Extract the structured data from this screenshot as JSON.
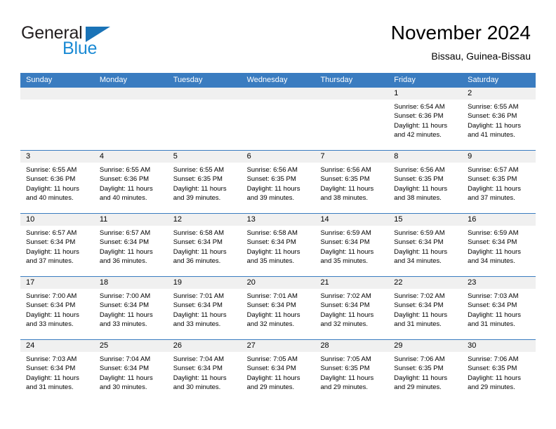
{
  "brand": {
    "name_part1": "General",
    "name_part2": "Blue",
    "accent_color": "#1a8ad4",
    "triangle_color": "#1a73b7"
  },
  "header": {
    "title": "November 2024",
    "subtitle": "Bissau, Guinea-Bissau"
  },
  "calendar": {
    "header_bg": "#3a7cc0",
    "daynum_bg": "#f0f0f0",
    "weekdays": [
      "Sunday",
      "Monday",
      "Tuesday",
      "Wednesday",
      "Thursday",
      "Friday",
      "Saturday"
    ],
    "weeks": [
      [
        {
          "day": "",
          "lines": []
        },
        {
          "day": "",
          "lines": []
        },
        {
          "day": "",
          "lines": []
        },
        {
          "day": "",
          "lines": []
        },
        {
          "day": "",
          "lines": []
        },
        {
          "day": "1",
          "lines": [
            "Sunrise: 6:54 AM",
            "Sunset: 6:36 PM",
            "Daylight: 11 hours",
            "and 42 minutes."
          ]
        },
        {
          "day": "2",
          "lines": [
            "Sunrise: 6:55 AM",
            "Sunset: 6:36 PM",
            "Daylight: 11 hours",
            "and 41 minutes."
          ]
        }
      ],
      [
        {
          "day": "3",
          "lines": [
            "Sunrise: 6:55 AM",
            "Sunset: 6:36 PM",
            "Daylight: 11 hours",
            "and 40 minutes."
          ]
        },
        {
          "day": "4",
          "lines": [
            "Sunrise: 6:55 AM",
            "Sunset: 6:36 PM",
            "Daylight: 11 hours",
            "and 40 minutes."
          ]
        },
        {
          "day": "5",
          "lines": [
            "Sunrise: 6:55 AM",
            "Sunset: 6:35 PM",
            "Daylight: 11 hours",
            "and 39 minutes."
          ]
        },
        {
          "day": "6",
          "lines": [
            "Sunrise: 6:56 AM",
            "Sunset: 6:35 PM",
            "Daylight: 11 hours",
            "and 39 minutes."
          ]
        },
        {
          "day": "7",
          "lines": [
            "Sunrise: 6:56 AM",
            "Sunset: 6:35 PM",
            "Daylight: 11 hours",
            "and 38 minutes."
          ]
        },
        {
          "day": "8",
          "lines": [
            "Sunrise: 6:56 AM",
            "Sunset: 6:35 PM",
            "Daylight: 11 hours",
            "and 38 minutes."
          ]
        },
        {
          "day": "9",
          "lines": [
            "Sunrise: 6:57 AM",
            "Sunset: 6:35 PM",
            "Daylight: 11 hours",
            "and 37 minutes."
          ]
        }
      ],
      [
        {
          "day": "10",
          "lines": [
            "Sunrise: 6:57 AM",
            "Sunset: 6:34 PM",
            "Daylight: 11 hours",
            "and 37 minutes."
          ]
        },
        {
          "day": "11",
          "lines": [
            "Sunrise: 6:57 AM",
            "Sunset: 6:34 PM",
            "Daylight: 11 hours",
            "and 36 minutes."
          ]
        },
        {
          "day": "12",
          "lines": [
            "Sunrise: 6:58 AM",
            "Sunset: 6:34 PM",
            "Daylight: 11 hours",
            "and 36 minutes."
          ]
        },
        {
          "day": "13",
          "lines": [
            "Sunrise: 6:58 AM",
            "Sunset: 6:34 PM",
            "Daylight: 11 hours",
            "and 35 minutes."
          ]
        },
        {
          "day": "14",
          "lines": [
            "Sunrise: 6:59 AM",
            "Sunset: 6:34 PM",
            "Daylight: 11 hours",
            "and 35 minutes."
          ]
        },
        {
          "day": "15",
          "lines": [
            "Sunrise: 6:59 AM",
            "Sunset: 6:34 PM",
            "Daylight: 11 hours",
            "and 34 minutes."
          ]
        },
        {
          "day": "16",
          "lines": [
            "Sunrise: 6:59 AM",
            "Sunset: 6:34 PM",
            "Daylight: 11 hours",
            "and 34 minutes."
          ]
        }
      ],
      [
        {
          "day": "17",
          "lines": [
            "Sunrise: 7:00 AM",
            "Sunset: 6:34 PM",
            "Daylight: 11 hours",
            "and 33 minutes."
          ]
        },
        {
          "day": "18",
          "lines": [
            "Sunrise: 7:00 AM",
            "Sunset: 6:34 PM",
            "Daylight: 11 hours",
            "and 33 minutes."
          ]
        },
        {
          "day": "19",
          "lines": [
            "Sunrise: 7:01 AM",
            "Sunset: 6:34 PM",
            "Daylight: 11 hours",
            "and 33 minutes."
          ]
        },
        {
          "day": "20",
          "lines": [
            "Sunrise: 7:01 AM",
            "Sunset: 6:34 PM",
            "Daylight: 11 hours",
            "and 32 minutes."
          ]
        },
        {
          "day": "21",
          "lines": [
            "Sunrise: 7:02 AM",
            "Sunset: 6:34 PM",
            "Daylight: 11 hours",
            "and 32 minutes."
          ]
        },
        {
          "day": "22",
          "lines": [
            "Sunrise: 7:02 AM",
            "Sunset: 6:34 PM",
            "Daylight: 11 hours",
            "and 31 minutes."
          ]
        },
        {
          "day": "23",
          "lines": [
            "Sunrise: 7:03 AM",
            "Sunset: 6:34 PM",
            "Daylight: 11 hours",
            "and 31 minutes."
          ]
        }
      ],
      [
        {
          "day": "24",
          "lines": [
            "Sunrise: 7:03 AM",
            "Sunset: 6:34 PM",
            "Daylight: 11 hours",
            "and 31 minutes."
          ]
        },
        {
          "day": "25",
          "lines": [
            "Sunrise: 7:04 AM",
            "Sunset: 6:34 PM",
            "Daylight: 11 hours",
            "and 30 minutes."
          ]
        },
        {
          "day": "26",
          "lines": [
            "Sunrise: 7:04 AM",
            "Sunset: 6:34 PM",
            "Daylight: 11 hours",
            "and 30 minutes."
          ]
        },
        {
          "day": "27",
          "lines": [
            "Sunrise: 7:05 AM",
            "Sunset: 6:34 PM",
            "Daylight: 11 hours",
            "and 29 minutes."
          ]
        },
        {
          "day": "28",
          "lines": [
            "Sunrise: 7:05 AM",
            "Sunset: 6:35 PM",
            "Daylight: 11 hours",
            "and 29 minutes."
          ]
        },
        {
          "day": "29",
          "lines": [
            "Sunrise: 7:06 AM",
            "Sunset: 6:35 PM",
            "Daylight: 11 hours",
            "and 29 minutes."
          ]
        },
        {
          "day": "30",
          "lines": [
            "Sunrise: 7:06 AM",
            "Sunset: 6:35 PM",
            "Daylight: 11 hours",
            "and 29 minutes."
          ]
        }
      ]
    ]
  }
}
